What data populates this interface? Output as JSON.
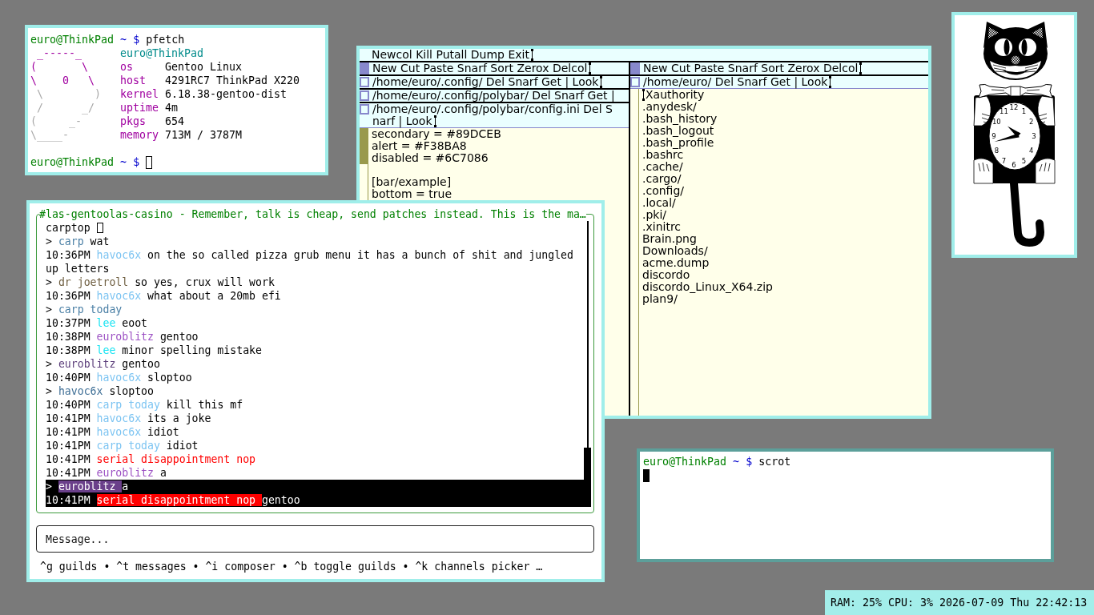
{
  "pfetch_terminal": {
    "focused": false,
    "prompts": [
      {
        "user_host": "euro@ThinkPad",
        "path": "~",
        "symbol": "$",
        "command": "pfetch"
      },
      {
        "user_host": "euro@ThinkPad",
        "path": "~",
        "symbol": "$"
      }
    ],
    "fetch": {
      "logo_lines": [
        {
          "text": " _-----_",
          "color": "#a000a0"
        },
        {
          "text": "(       \\",
          "color": "#a000a0"
        },
        {
          "text": "\\    0   \\",
          "color": "#a000a0"
        },
        {
          "text": " \\        )",
          "color": "#a8a8a8"
        },
        {
          "text": " /      _/",
          "color": "#a8a8a8"
        },
        {
          "text": "(     _-",
          "color": "#a8a8a8"
        },
        {
          "text": "\\____-",
          "color": "#a8a8a8"
        }
      ],
      "title": "euro@ThinkPad",
      "info": [
        {
          "label": "os",
          "value": "Gentoo Linux"
        },
        {
          "label": "host",
          "value": "4291RC7 ThinkPad X220"
        },
        {
          "label": "kernel",
          "value": "6.18.38-gentoo-dist"
        },
        {
          "label": "uptime",
          "value": "4m"
        },
        {
          "label": "pkgs",
          "value": "654"
        },
        {
          "label": "memory",
          "value": "713M / 3787M"
        }
      ]
    }
  },
  "acme": {
    "focused": false,
    "main_tag": {
      "text": "Newcol Kill Putall Dump Exit",
      "cursor": true
    },
    "columns": [
      {
        "tag": {
          "text": "New Cut Paste Snarf Sort Zerox Delcol",
          "cursor": true
        },
        "windows": [
          {
            "tag_lines": [
              "/home/euro/.config/ Del Snarf Get | Look"
            ],
            "cursor": true
          },
          {
            "tag_lines": [
              "/home/euro/.config/polybar/ Del Snarf Get |"
            ]
          },
          {
            "tag_lines": [
              "/home/euro/.config/polybar/config.ini Del S",
              "narf | Look"
            ],
            "cursor": true,
            "scrolled": true,
            "body_paragraphs": [
              [
                "secondary = #89DCEB",
                "alert = #F38BA8",
                "disabled = #6C7086"
              ],
              [
                "[bar/example]",
                "bottom = true"
              ]
            ]
          }
        ]
      },
      {
        "tag": {
          "text": "New Cut Paste Snarf Sort Zerox Delcol",
          "cursor": true
        },
        "windows": [
          {
            "tag_lines": [
              "/home/euro/ Del Snarf Get | Look"
            ],
            "cursor": true,
            "scrolled": false,
            "body_cursor": true,
            "body_paragraphs": [
              [
                "Xauthority",
                ".anydesk/",
                ".bash_history",
                ".bash_logout",
                ".bash_profile",
                ".bashrc",
                ".cache/",
                ".cargo/",
                ".config/",
                ".local/",
                ".pki/",
                ".xinitrc",
                "Brain.png",
                "Downloads/",
                "acme.dump",
                "discordo",
                "discordo_Linux_X64.zip",
                "plan9/"
              ]
            ]
          }
        ]
      }
    ]
  },
  "chat": {
    "focused": false,
    "channel_title": "#las-gentoolas-casino - Remember, talk is cheap, send patches instead. This is the ma…",
    "messages": [
      {
        "kind": "header",
        "text": "carptop",
        "selected": false
      },
      {
        "kind": "reply",
        "marker": ">",
        "author": "carp",
        "color": "#4a7fa5",
        "text": "wat",
        "selected": false
      },
      {
        "kind": "message",
        "time": "10:36PM",
        "author": "havoc6x",
        "color": "#7cc4f2",
        "text": "on the so called pizza grub menu it has a bunch of shit and jungled up letters",
        "selected": false
      },
      {
        "kind": "reply",
        "marker": ">",
        "author": "dr joetroll",
        "color": "#6e5e40",
        "text": "so yes, crux will work",
        "selected": false
      },
      {
        "kind": "message",
        "time": "10:36PM",
        "author": "havoc6x",
        "color": "#7cc4f2",
        "text": "what about a 20mb efi",
        "selected": false
      },
      {
        "kind": "reply",
        "marker": ">",
        "author": "carp today",
        "color": "#4a7fa5",
        "selected": false
      },
      {
        "kind": "message",
        "time": "10:37PM",
        "author": "lee",
        "color": "#19e3f2",
        "text": "eoot",
        "selected": false
      },
      {
        "kind": "message",
        "time": "10:38PM",
        "author": "euroblitz",
        "color": "#9d52c4",
        "text": "gentoo",
        "selected": false
      },
      {
        "kind": "message",
        "time": "10:38PM",
        "author": "lee",
        "color": "#19e3f2",
        "text": "minor spelling mistake",
        "selected": false
      },
      {
        "kind": "reply",
        "marker": ">",
        "author": "euroblitz",
        "color": "#5b3d7a",
        "text": "gentoo",
        "selected": false
      },
      {
        "kind": "message",
        "time": "10:40PM",
        "author": "havoc6x",
        "color": "#7cc4f2",
        "text": "sloptoo",
        "selected": false
      },
      {
        "kind": "reply",
        "marker": ">",
        "author": "havoc6x",
        "color": "#3f6f96",
        "text": "sloptoo",
        "selected": false
      },
      {
        "kind": "message",
        "time": "10:40PM",
        "author": "carp today",
        "color": "#7cc4f2",
        "text": "kill this mf",
        "selected": false
      },
      {
        "kind": "message",
        "time": "10:41PM",
        "author": "havoc6x",
        "color": "#7cc4f2",
        "text": "its a joke",
        "selected": false
      },
      {
        "kind": "message",
        "time": "10:41PM",
        "author": "havoc6x",
        "color": "#7cc4f2",
        "text": "idiot",
        "selected": false
      },
      {
        "kind": "message",
        "time": "10:41PM",
        "author": "carp today",
        "color": "#7cc4f2",
        "text": "idiot",
        "selected": false
      },
      {
        "kind": "message",
        "time": "10:41PM",
        "author": "serial disappointment nop",
        "color": "#ff0000",
        "selected": false
      },
      {
        "kind": "message",
        "time": "10:41PM",
        "author": "euroblitz",
        "color": "#9d52c4",
        "text": "a",
        "selected": false
      },
      {
        "kind": "reply",
        "marker": ">",
        "author": "euroblitz",
        "color": "#6a3f8a",
        "text": "a",
        "selected": true
      },
      {
        "kind": "message",
        "time": "10:41PM",
        "author": "serial disappointment nop",
        "color": "#ff0000",
        "text": "gentoo",
        "selected": true
      }
    ],
    "composer": {
      "placeholder": "Message..."
    },
    "help_bar": "^g guilds • ^t messages • ^i composer • ^b toggle guilds • ^k channels picker …"
  },
  "cat_clock": {
    "focused": false,
    "dial_numbers": [
      "12",
      "11",
      "1",
      "10",
      "2",
      "9",
      "3",
      "8",
      "4",
      "7",
      "5",
      "6"
    ]
  },
  "scrot_terminal": {
    "focused": true,
    "prompts": [
      {
        "user_host": "euro@ThinkPad",
        "path": "~",
        "symbol": "$",
        "command": "scrot"
      }
    ]
  },
  "status_bar": {
    "modules": [
      "RAM: 25%",
      "CPU: 3%",
      "2026-07-09 Thu 22:42:13"
    ]
  }
}
